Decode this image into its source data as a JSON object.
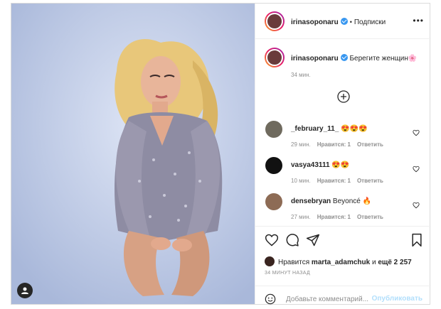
{
  "header": {
    "username": "irinasoponaru",
    "separator": "•",
    "follow_label": "Подписки",
    "more": "•••"
  },
  "caption": {
    "username": "irinasoponaru",
    "text": "Берегите женщин🌸",
    "time": "34 мин."
  },
  "comments": [
    {
      "username": "_february_11_",
      "text": "😍😍😍",
      "time": "29 мин.",
      "likes": "Нравится: 1",
      "reply": "Ответить"
    },
    {
      "username": "vasya43111",
      "text": "😍😍",
      "time": "10 мин.",
      "likes": "Нравится: 1",
      "reply": "Ответить"
    },
    {
      "username": "densebryan",
      "text": "Beyoncé 🔥",
      "time": "27 мин.",
      "likes": "Нравится: 1",
      "reply": "Ответить"
    }
  ],
  "likes": {
    "prefix": "Нравится",
    "user": "marta_adamchuk",
    "conj": "и",
    "more": "ещё 2 257"
  },
  "posted_time": "34 МИНУТ НАЗАД",
  "add_comment": {
    "placeholder": "Добавьте комментарий...",
    "publish_label": "Опубликовать"
  },
  "icons": {
    "verified": "verified-badge-icon",
    "load_more": "plus-circle-icon",
    "like": "heart-icon",
    "comment": "comment-icon",
    "share": "send-icon",
    "save": "bookmark-icon",
    "emoji": "smile-icon",
    "tag": "user-tag-icon"
  },
  "colors": {
    "verified": "#3897f0",
    "publish_disabled": "#b2dffc",
    "muted": "#8e8e8e"
  }
}
